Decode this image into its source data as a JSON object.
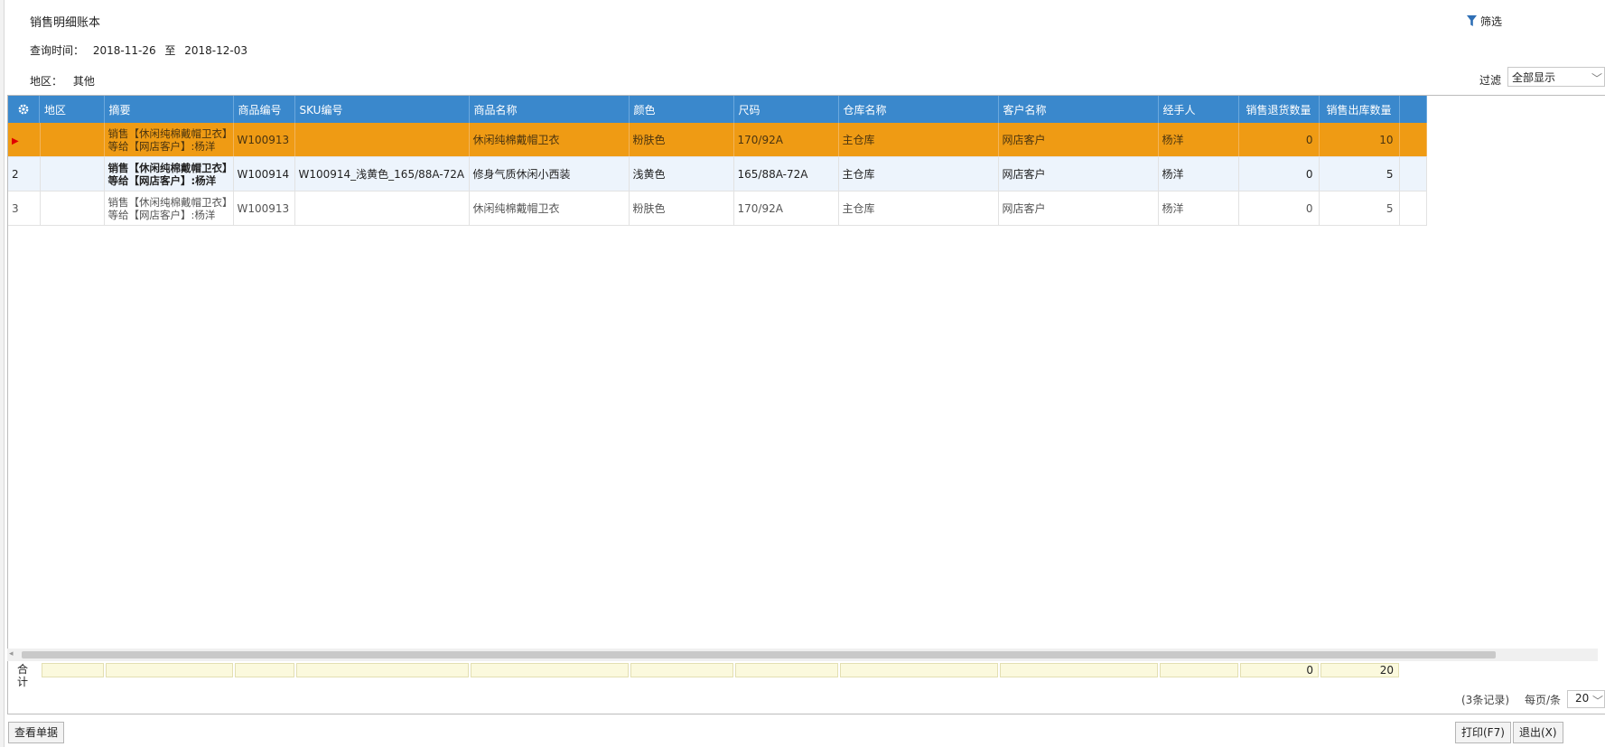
{
  "title": "销售明细账本",
  "query": {
    "label": "查询时间：",
    "from": "2018-11-26",
    "to_label": "至",
    "to": "2018-12-03"
  },
  "region": {
    "label": "地区：",
    "value": "其他"
  },
  "filter_button": "筛选",
  "filter": {
    "label": "过滤",
    "selected": "全部显示"
  },
  "columns": [
    "地区",
    "摘要",
    "商品编号",
    "SKU编号",
    "商品名称",
    "颜色",
    "尺码",
    "仓库名称",
    "客户名称",
    "经手人",
    "销售退货数量",
    "销售出库数量"
  ],
  "rows": [
    {
      "no": "",
      "region": "",
      "summary1": "销售【休闲纯棉戴帽卫衣】",
      "summary2": "等给【网店客户】:杨洋",
      "code": "W100913",
      "sku": "",
      "name": "休闲纯棉戴帽卫衣",
      "color": "粉肤色",
      "size": "170/92A",
      "warehouse": "主仓库",
      "customer": "网店客户",
      "handler": "杨洋",
      "return_qty": "0",
      "out_qty": "10"
    },
    {
      "no": "2",
      "region": "",
      "summary1": "销售【休闲纯棉戴帽卫衣】",
      "summary2": "等给【网店客户】:杨洋",
      "code": "W100914",
      "sku": "W100914_浅黄色_165/88A-72A",
      "name": "修身气质休闲小西装",
      "color": "浅黄色",
      "size": "165/88A-72A",
      "warehouse": "主仓库",
      "customer": "网店客户",
      "handler": "杨洋",
      "return_qty": "0",
      "out_qty": "5"
    },
    {
      "no": "3",
      "region": "",
      "summary1": "销售【休闲纯棉戴帽卫衣】",
      "summary2": "等给【网店客户】:杨洋",
      "code": "W100913",
      "sku": "",
      "name": "休闲纯棉戴帽卫衣",
      "color": "粉肤色",
      "size": "170/92A",
      "warehouse": "主仓库",
      "customer": "网店客户",
      "handler": "杨洋",
      "return_qty": "0",
      "out_qty": "5"
    }
  ],
  "totals": {
    "label": "合计",
    "return_qty": "0",
    "out_qty": "20"
  },
  "pager": {
    "records": "(3条记录)",
    "per_page_label": "每页/条",
    "per_page": "20"
  },
  "buttons": {
    "view": "查看单据",
    "print": "打印(F7)",
    "exit": "退出(X)"
  },
  "colors": {
    "header_bg": "#3a88cc",
    "selected_row": "#ef9b14",
    "alt_row": "#edf4fc",
    "totals_bg": "#fbf9dd"
  }
}
